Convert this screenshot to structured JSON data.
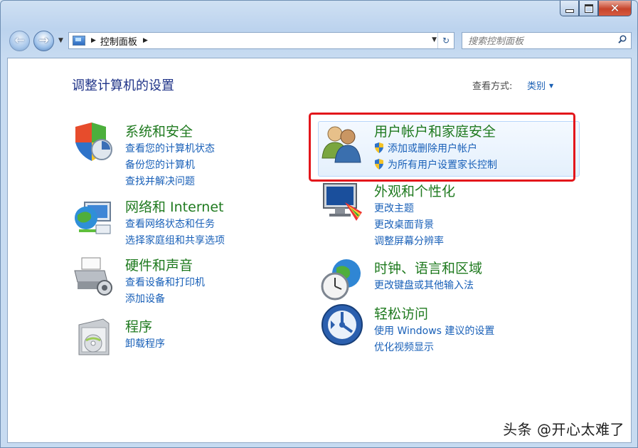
{
  "window": {
    "minimize_icon": "minimize-icon",
    "maximize_icon": "maximize-icon",
    "close_glyph": "✕"
  },
  "nav": {
    "back_glyph": "←",
    "forward_glyph": "→",
    "address_text": "控制面板",
    "search_placeholder": "搜索控制面板"
  },
  "header": {
    "title": "调整计算机的设置",
    "view_label": "查看方式:",
    "view_value": "类别"
  },
  "categories": [
    {
      "title": "系统和安全",
      "links": [
        "查看您的计算机状态",
        "备份您的计算机",
        "查找并解决问题"
      ],
      "icon": "shield-security-icon"
    },
    {
      "title": "网络和 Internet",
      "links": [
        "查看网络状态和任务",
        "选择家庭组和共享选项"
      ],
      "icon": "network-globe-icon"
    },
    {
      "title": "硬件和声音",
      "links": [
        "查看设备和打印机",
        "添加设备"
      ],
      "icon": "printer-icon"
    },
    {
      "title": "程序",
      "links": [
        "卸载程序"
      ],
      "icon": "programs-disc-icon"
    },
    {
      "title": "用户帐户和家庭安全",
      "links": [
        "添加或删除用户帐户",
        "为所有用户设置家长控制"
      ],
      "icon": "users-icon"
    },
    {
      "title": "外观和个性化",
      "links": [
        "更改主题",
        "更改桌面背景",
        "调整屏幕分辨率"
      ],
      "icon": "monitor-palette-icon"
    },
    {
      "title": "时钟、语言和区域",
      "links": [
        "更改键盘或其他输入法"
      ],
      "icon": "clock-globe-icon"
    },
    {
      "title": "轻松访问",
      "links": [
        "使用 Windows 建议的设置",
        "优化视频显示"
      ],
      "icon": "ease-of-access-icon"
    }
  ],
  "watermark": "头条 @开心太难了",
  "colors": {
    "link": "#1960b8",
    "category_title": "#1f7a1f",
    "highlight": "#e3161b"
  }
}
